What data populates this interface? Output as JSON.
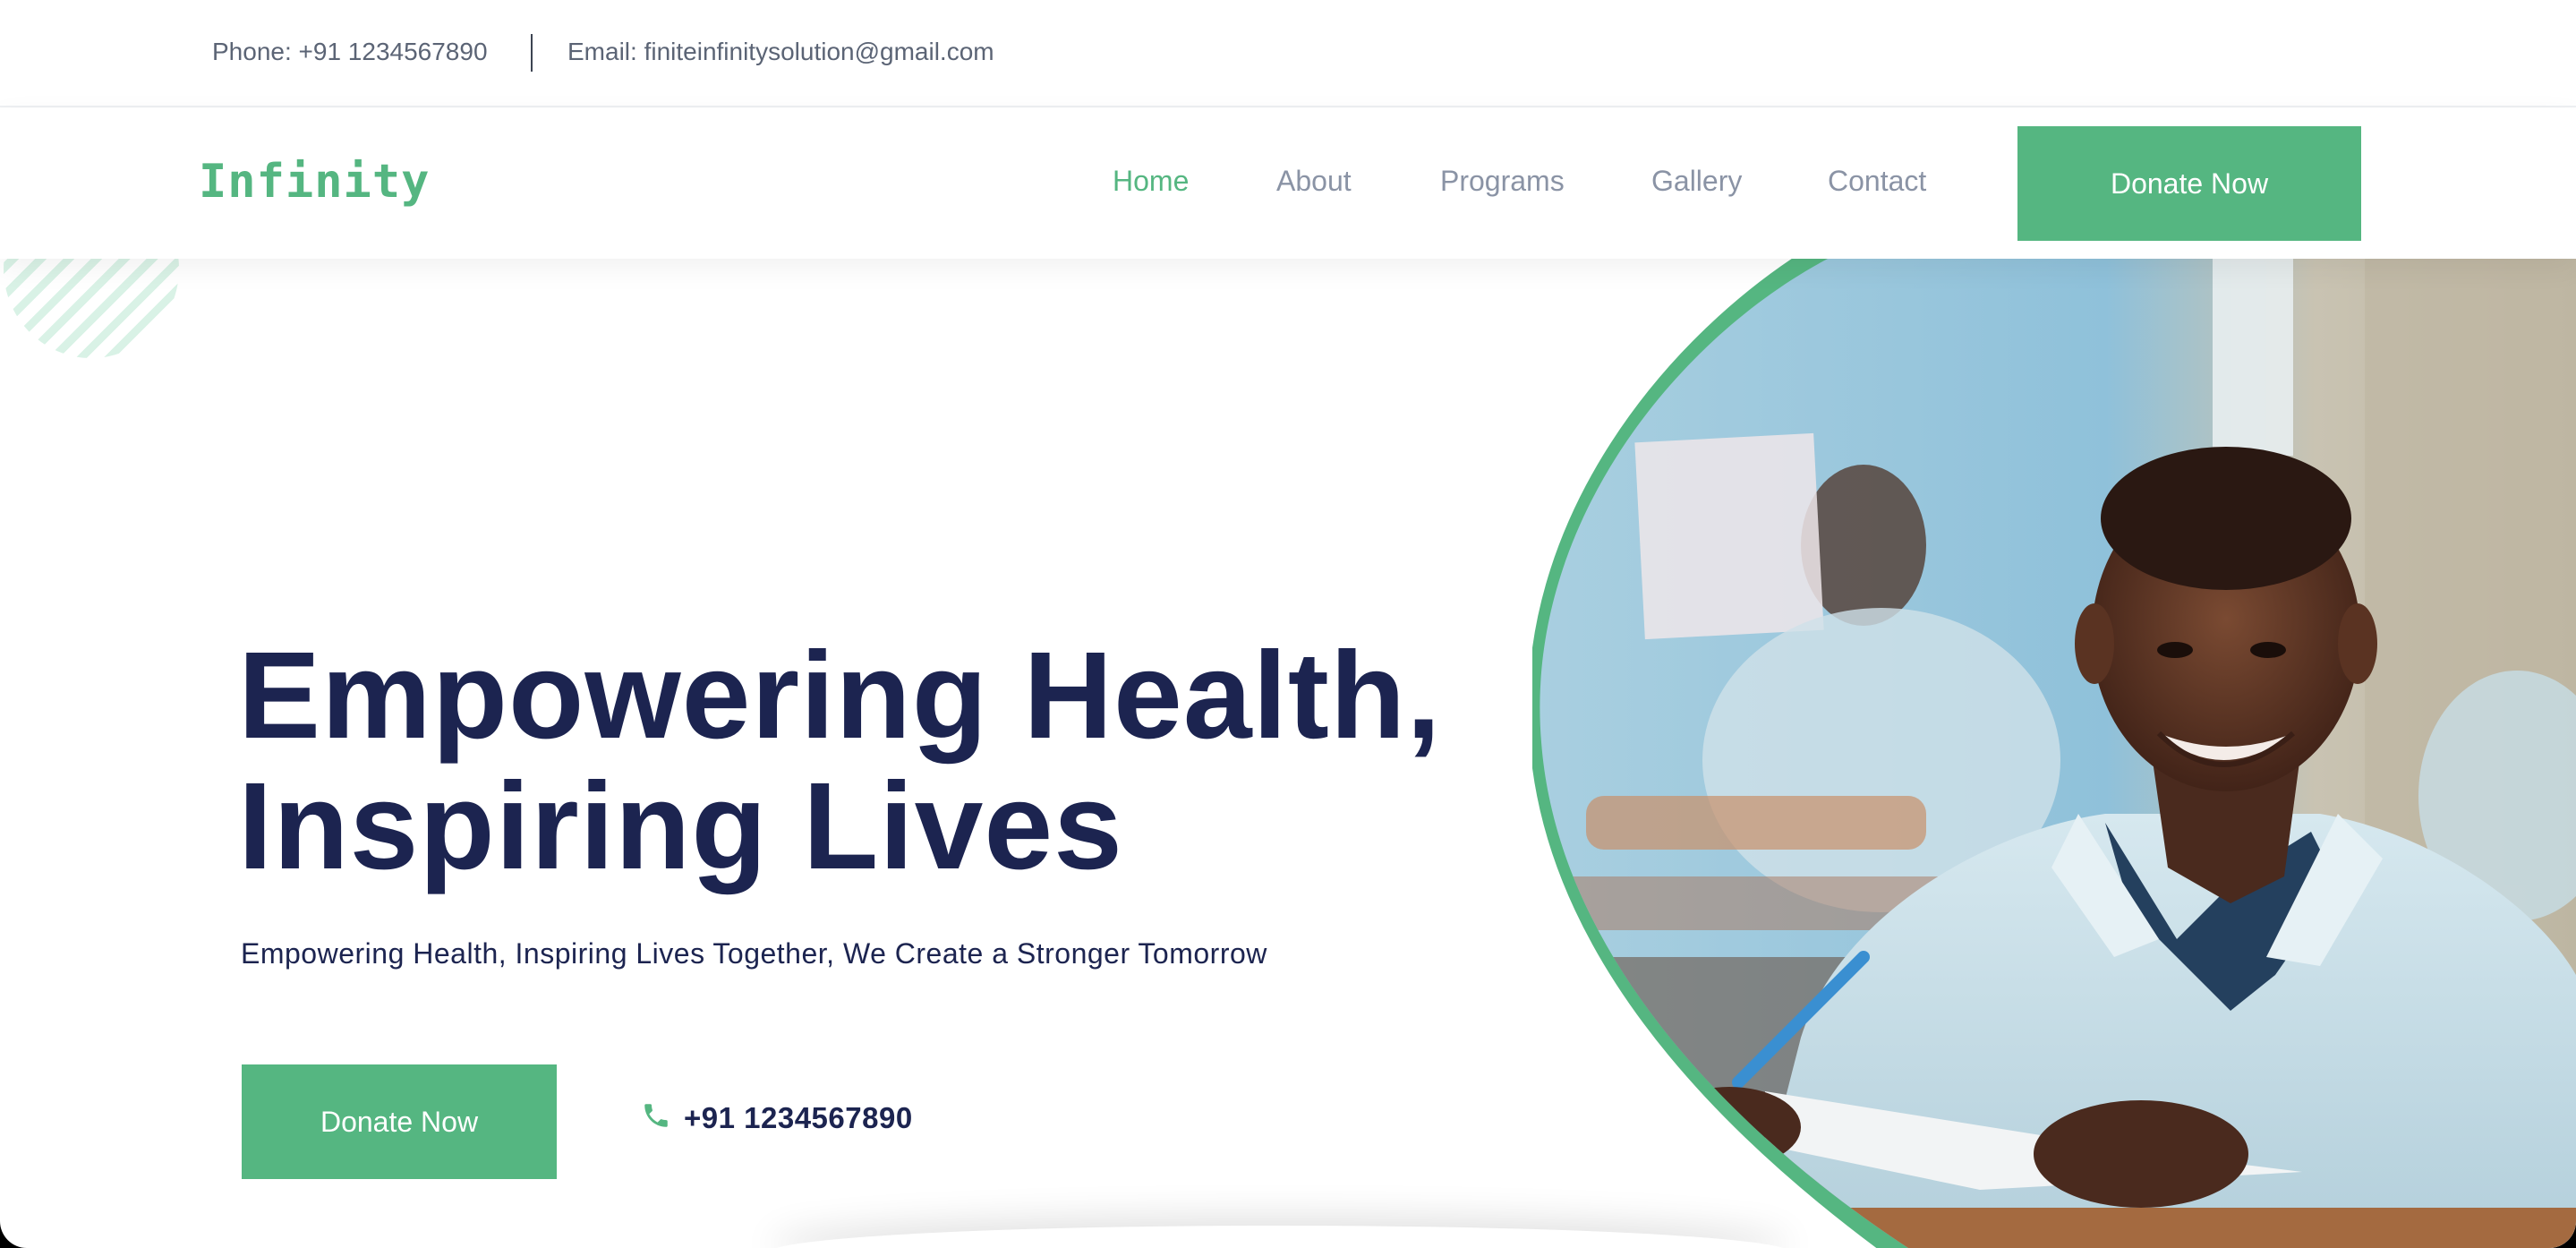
{
  "topbar": {
    "phone": "Phone: +91 1234567890",
    "email": "Email: finiteinfinitysolution@gmail.com"
  },
  "nav": {
    "logo": "Infinity",
    "links": [
      "Home",
      "About",
      "Programs",
      "Gallery",
      "Contact"
    ],
    "active": "Home",
    "donate_label": "Donate Now"
  },
  "hero": {
    "title_line1": "Empowering Health,",
    "title_line2": "Inspiring Lives",
    "subtitle": "Empowering Health, Inspiring Lives Together, We Create a Stronger Tomorrow",
    "donate_label": "Donate Now",
    "phone": "+91 1234567890",
    "phone_icon": "phone-icon",
    "image": "smiling-student-photo"
  },
  "colors": {
    "accent": "#55b681",
    "heading": "#1c2450",
    "muted": "#8a93a5"
  }
}
